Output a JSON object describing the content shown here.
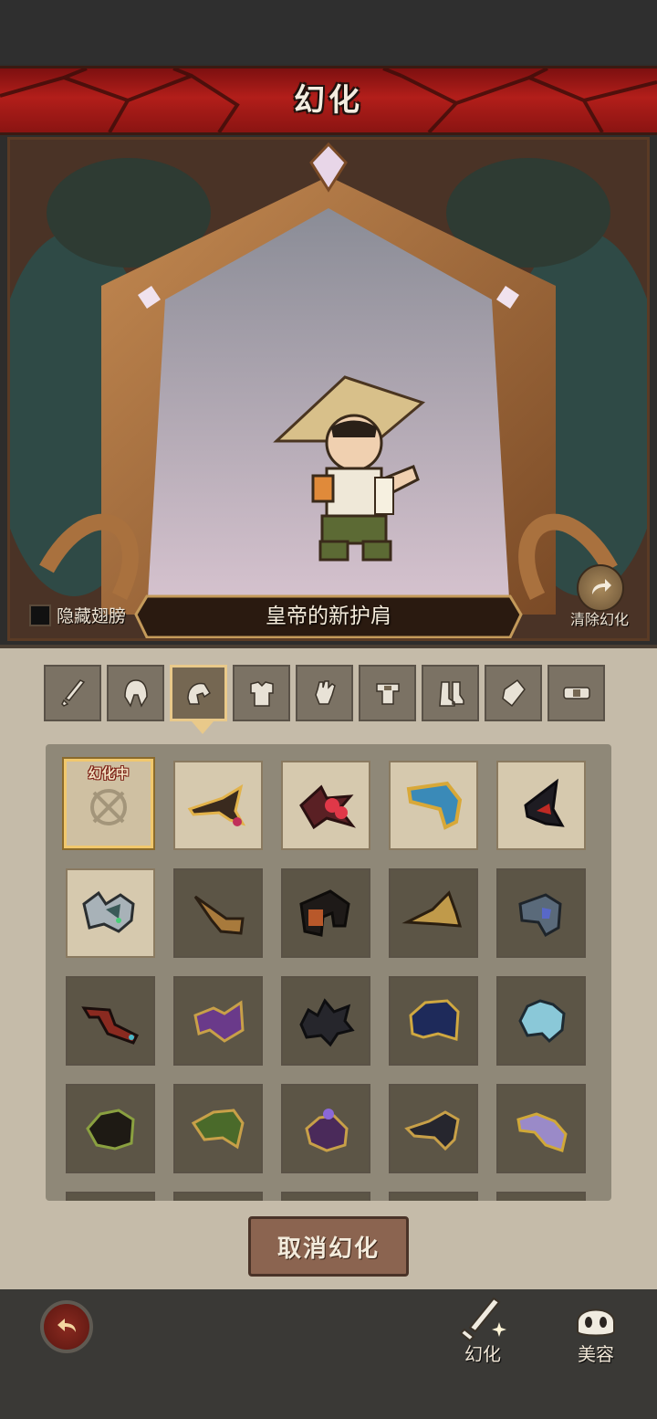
{
  "header": {
    "title": "幻化"
  },
  "preview": {
    "hide_wings_label": "隐藏翅膀",
    "item_name": "皇帝的新护肩",
    "clear_label": "清除幻化"
  },
  "tabs": [
    {
      "icon": "sword-icon"
    },
    {
      "icon": "helmet-icon"
    },
    {
      "icon": "shoulder-icon",
      "active": true
    },
    {
      "icon": "armor-icon"
    },
    {
      "icon": "glove-icon"
    },
    {
      "icon": "belt-icon"
    },
    {
      "icon": "boots-icon"
    },
    {
      "icon": "bracer-icon"
    },
    {
      "icon": "misc-icon"
    }
  ],
  "grid": {
    "selected_badge": "幻化中",
    "items": [
      {
        "icon": "none-icon",
        "state": "selected"
      },
      {
        "icon": "gold-spike-pauldron-icon",
        "state": "owned"
      },
      {
        "icon": "rose-thorn-pauldron-icon",
        "state": "owned"
      },
      {
        "icon": "blue-gold-pauldron-icon",
        "state": "owned"
      },
      {
        "icon": "black-horn-pauldron-icon",
        "state": "owned"
      },
      {
        "icon": "silver-spike-pauldron-icon",
        "state": "owned"
      },
      {
        "icon": "brown-horn-pauldron-icon",
        "state": "locked"
      },
      {
        "icon": "orange-box-pauldron-icon",
        "state": "locked"
      },
      {
        "icon": "gold-plate-pauldron-icon",
        "state": "locked"
      },
      {
        "icon": "steel-shield-pauldron-icon",
        "state": "locked"
      },
      {
        "icon": "red-hook-pauldron-icon",
        "state": "locked"
      },
      {
        "icon": "purple-gold-pauldron-icon",
        "state": "locked"
      },
      {
        "icon": "black-fur-pauldron-icon",
        "state": "locked"
      },
      {
        "icon": "navy-gold-pauldron-icon",
        "state": "locked"
      },
      {
        "icon": "ice-crystal-pauldron-icon",
        "state": "locked"
      },
      {
        "icon": "green-claw-pauldron-icon",
        "state": "locked"
      },
      {
        "icon": "green-gold-pauldron-icon",
        "state": "locked"
      },
      {
        "icon": "violet-orb-pauldron-icon",
        "state": "locked"
      },
      {
        "icon": "dark-wing-pauldron-icon",
        "state": "locked"
      },
      {
        "icon": "lavender-gold-pauldron-icon",
        "state": "locked"
      }
    ]
  },
  "cancel_button": {
    "label": "取消幻化"
  },
  "bottom_nav": {
    "transform_label": "幻化",
    "beauty_label": "美容"
  },
  "colors": {
    "accent_gold": "#f1c86d",
    "banner_red": "#b21e1a"
  }
}
